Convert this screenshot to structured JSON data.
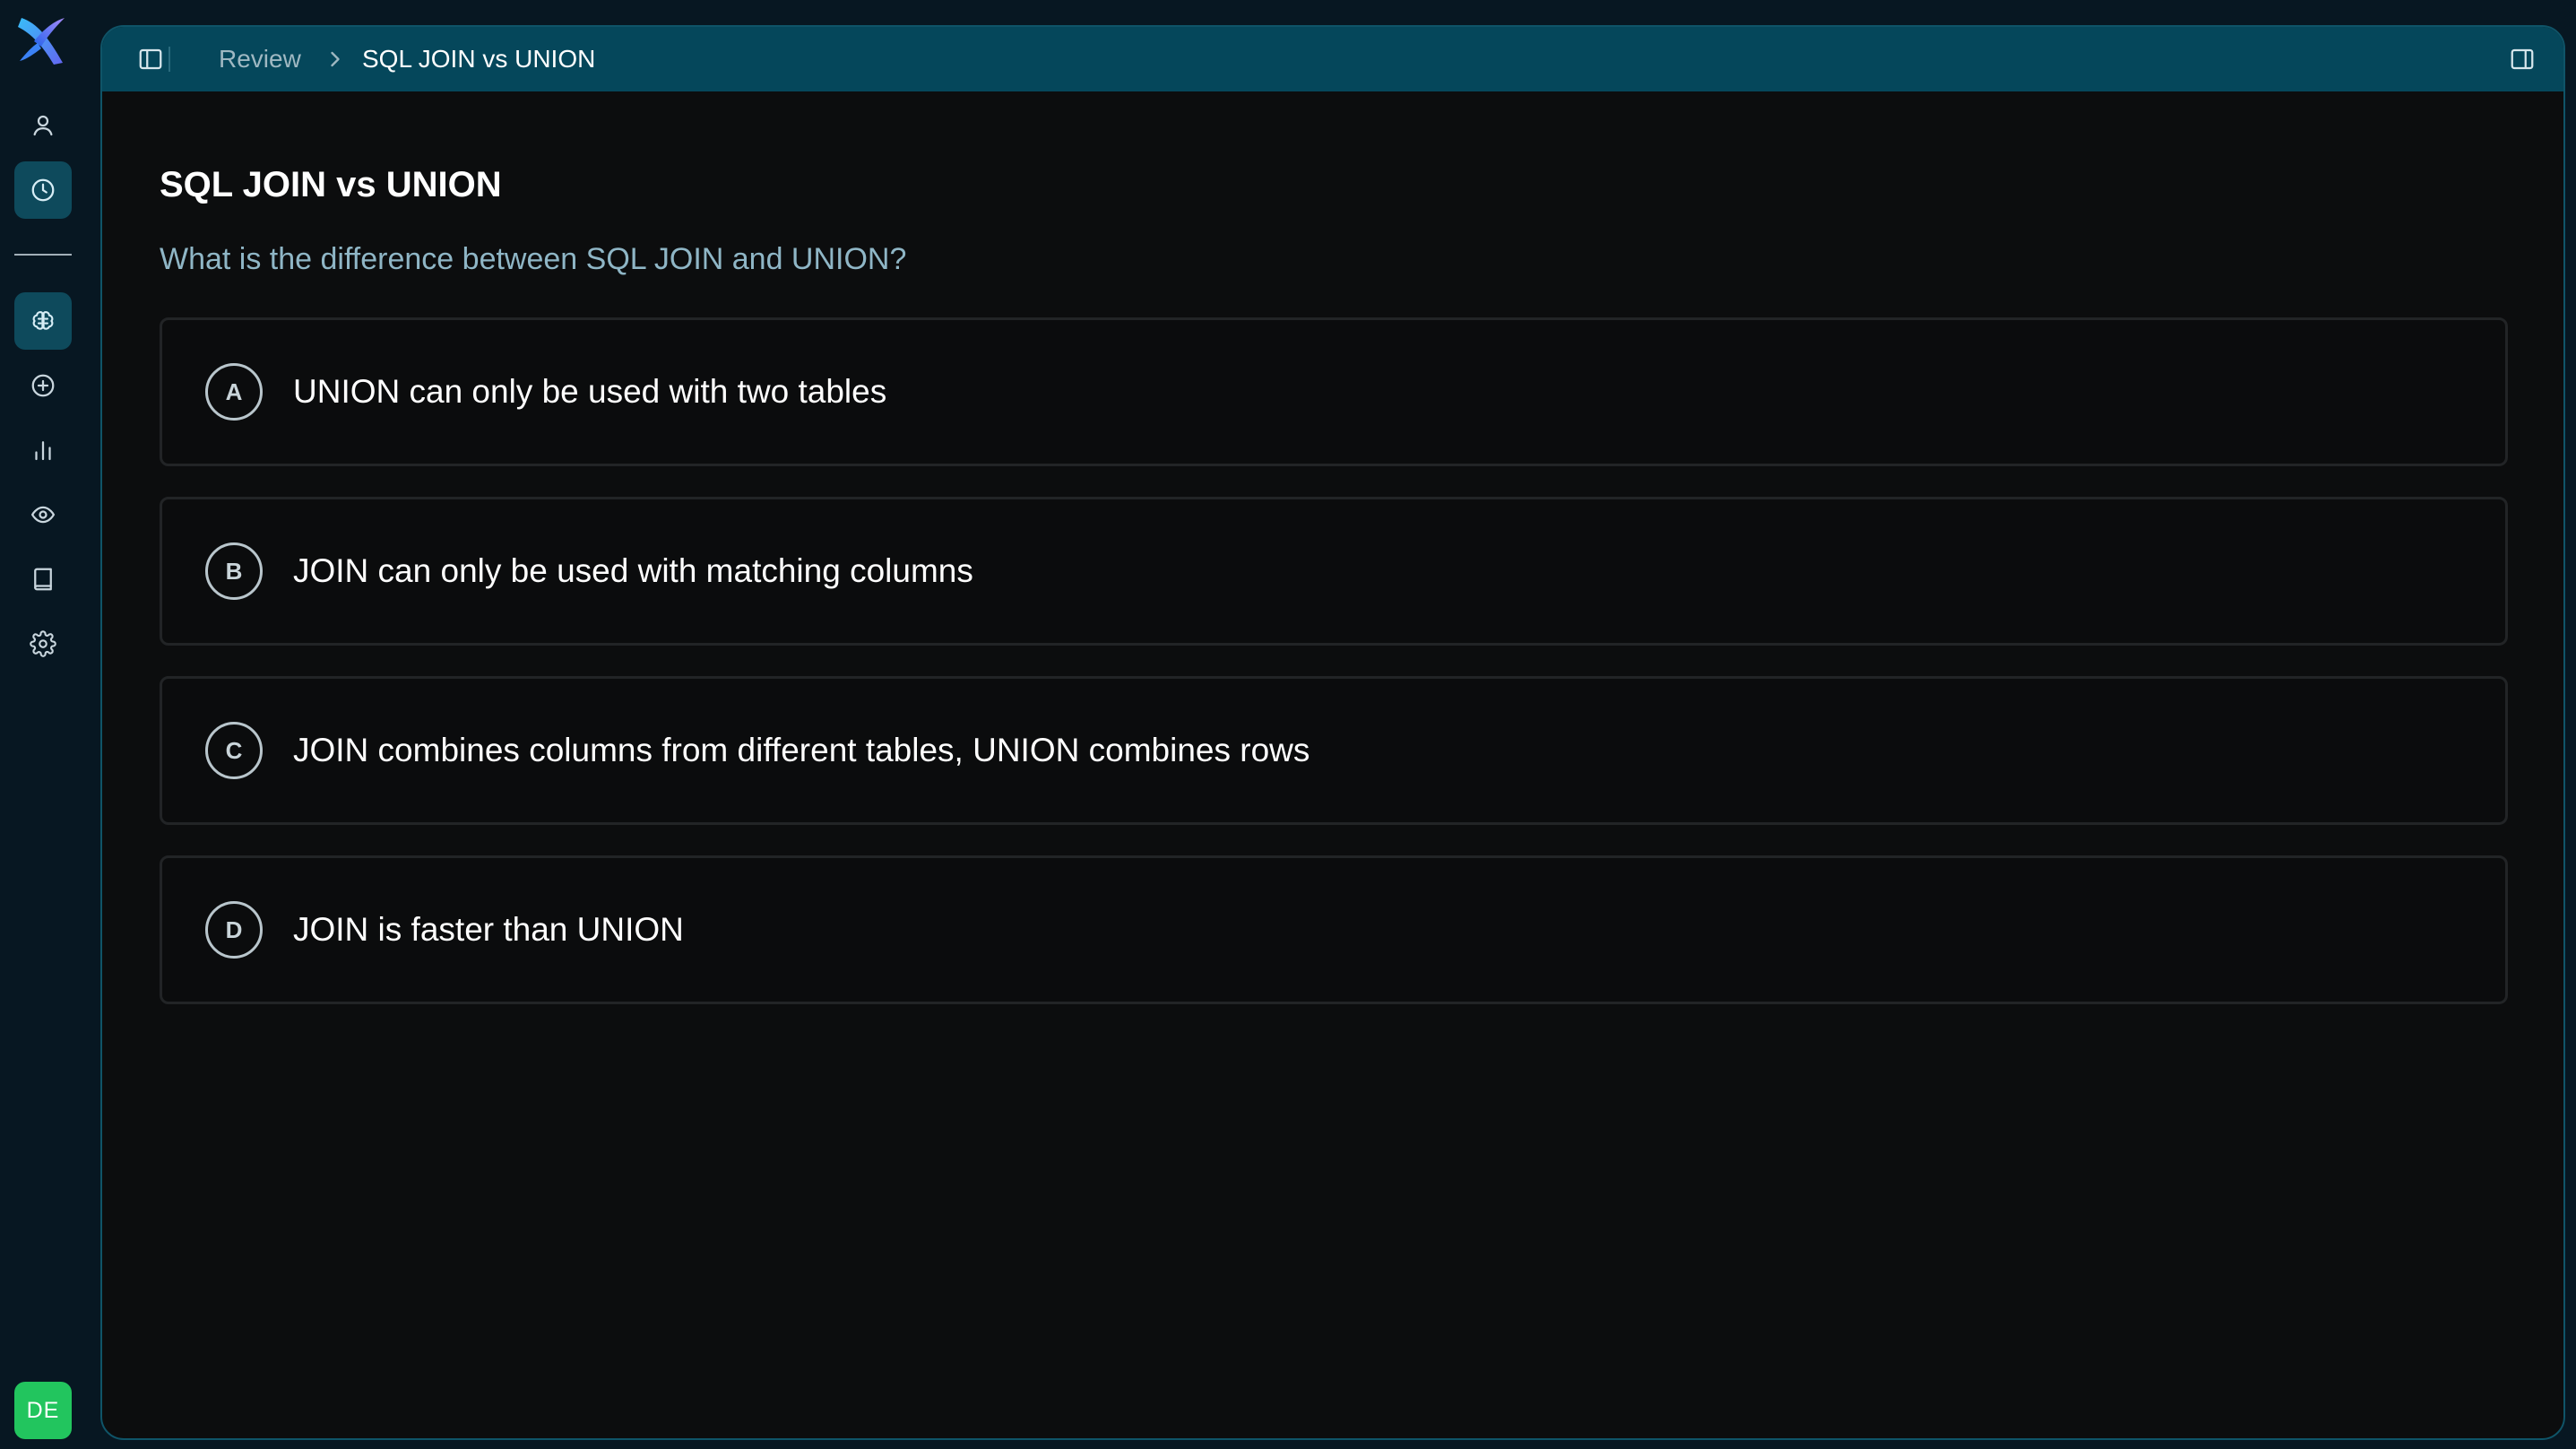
{
  "app": {
    "avatar_initials": "DE",
    "accent_color": "#0e4a5c",
    "avatar_color": "#22c55e"
  },
  "sidebar": {
    "items": [
      {
        "icon": "user-icon",
        "active": false
      },
      {
        "icon": "clock-icon",
        "active": true
      },
      {
        "icon": "brain-icon",
        "active": true
      },
      {
        "icon": "plus-circle-icon",
        "active": false
      },
      {
        "icon": "bar-chart-icon",
        "active": false
      },
      {
        "icon": "eye-icon",
        "active": false
      },
      {
        "icon": "book-icon",
        "active": false
      },
      {
        "icon": "gear-icon",
        "active": false
      }
    ]
  },
  "topbar": {
    "breadcrumb": {
      "parent": "Review",
      "current": "SQL JOIN vs UNION"
    }
  },
  "main": {
    "title": "SQL JOIN vs UNION",
    "question": "What is the difference between SQL JOIN and UNION?",
    "options": [
      {
        "letter": "A",
        "text": "UNION can only be used with two tables"
      },
      {
        "letter": "B",
        "text": "JOIN can only be used with matching columns"
      },
      {
        "letter": "C",
        "text": "JOIN combines columns from different tables, UNION combines rows"
      },
      {
        "letter": "D",
        "text": "JOIN is faster than UNION"
      }
    ]
  }
}
